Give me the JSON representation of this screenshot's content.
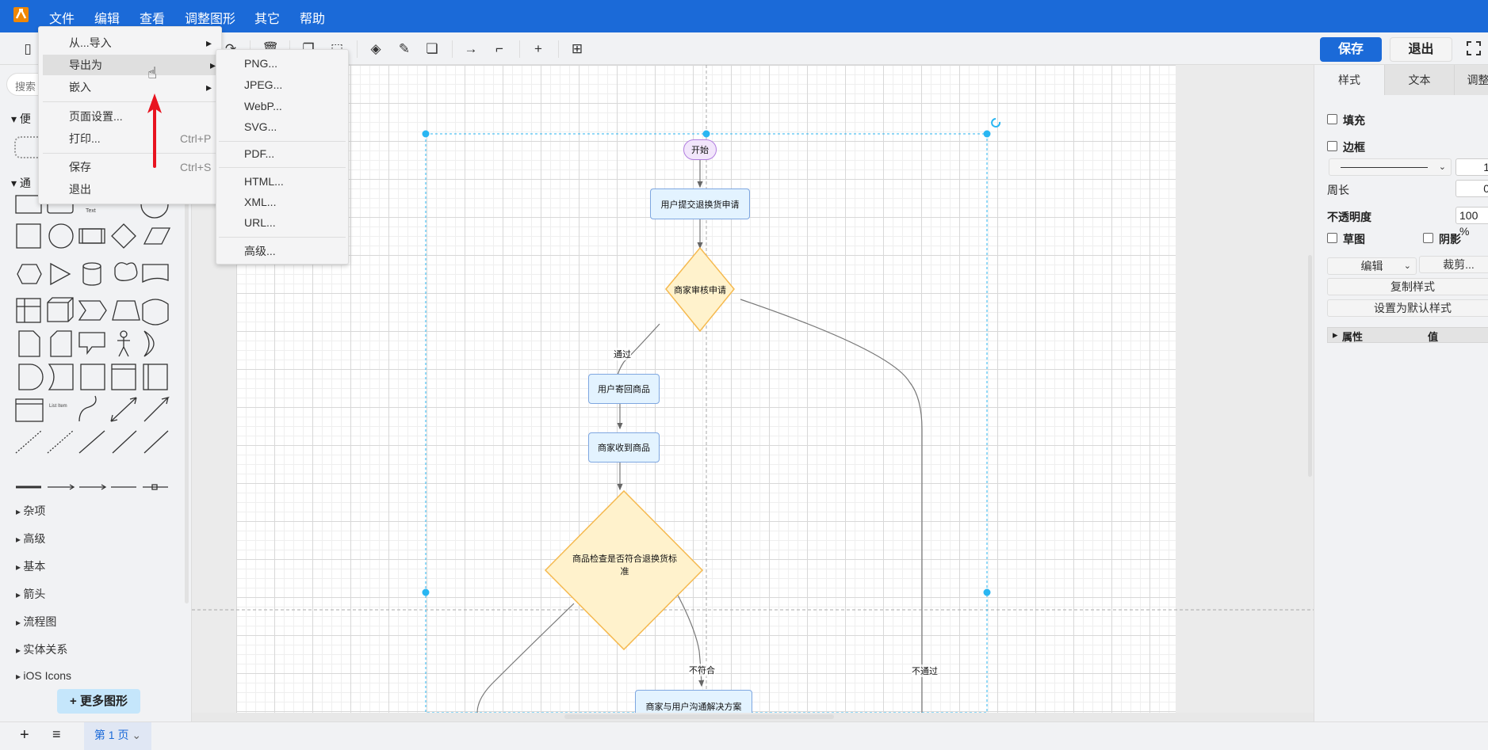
{
  "menubar": {
    "items": [
      "文件",
      "编辑",
      "查看",
      "调整图形",
      "其它",
      "帮助"
    ]
  },
  "toolbar": {
    "save": "保存",
    "exit": "退出"
  },
  "file_menu": {
    "items": [
      {
        "label": "从...导入",
        "submenu": true
      },
      {
        "label": "导出为",
        "submenu": true,
        "highlighted": true
      },
      {
        "label": "嵌入",
        "submenu": true
      },
      {
        "label": "页面设置..."
      },
      {
        "label": "打印...",
        "shortcut": "Ctrl+P"
      },
      {
        "label": "保存",
        "shortcut": "Ctrl+S"
      },
      {
        "label": "退出"
      }
    ]
  },
  "export_menu": {
    "items": [
      "PNG...",
      "JPEG...",
      "WebP...",
      "SVG...",
      "PDF...",
      "HTML...",
      "XML...",
      "URL...",
      "高级..."
    ]
  },
  "sidebar": {
    "search_placeholder": "搜索",
    "section1": "便",
    "section2": "通",
    "text_shape": "Text",
    "list_item": "List Item",
    "categories": [
      "杂项",
      "高级",
      "基本",
      "箭头",
      "流程图",
      "实体关系",
      "iOS Icons"
    ],
    "more_shapes": "更多图形"
  },
  "diagram": {
    "start": "开始",
    "submit": "用户提交退换货申请",
    "review": "商家审核申请",
    "pass": "通过",
    "send_back": "用户寄回商品",
    "received": "商家收到商品",
    "check": "商品检查是否符合退换货标准",
    "not_match": "不符合",
    "negotiate": "商家与用户沟通解决方案",
    "not_pass": "不通过"
  },
  "bottom": {
    "page_tab": "第 1 页"
  },
  "right_panel": {
    "tabs": [
      "样式",
      "文本",
      "调整"
    ],
    "fill": "填充",
    "border": "边框",
    "border_width": "1",
    "perimeter": "周长",
    "perimeter_value": "0",
    "opacity": "不透明度",
    "opacity_value": "100 %",
    "sketch": "草图",
    "shadow": "阴影",
    "edit": "编辑",
    "crop": "裁剪...",
    "copy_style": "复制样式",
    "set_default": "设置为默认样式",
    "prop_header": "属性",
    "value_header": "值"
  },
  "colors": {
    "brand": "#1b6ad8",
    "selection": "#29b6f2",
    "process_fill": "#e3f3ff",
    "decision_fill": "#fff2cc",
    "start_fill": "#f2e6fb"
  }
}
